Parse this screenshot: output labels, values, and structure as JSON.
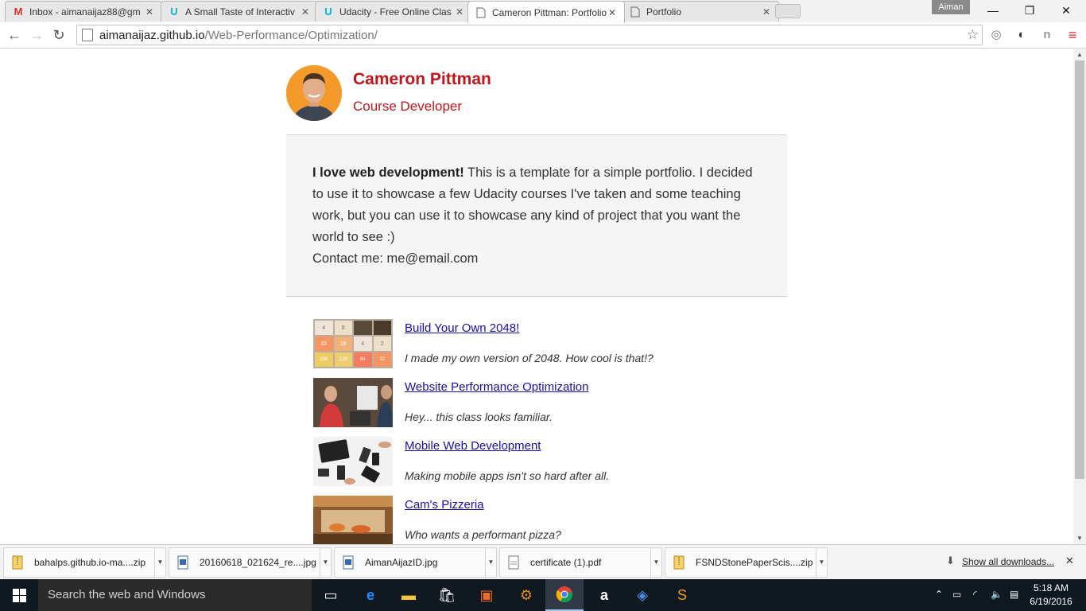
{
  "browser": {
    "tabs": [
      {
        "title": "Inbox - aimanaijaz88@gm",
        "icon": "gmail-icon"
      },
      {
        "title": "A Small Taste of Interactiv",
        "icon": "udacity-icon"
      },
      {
        "title": "Udacity - Free Online Clas",
        "icon": "udacity-icon"
      },
      {
        "title": "Cameron Pittman: Portfolio",
        "icon": "page-icon"
      },
      {
        "title": "Portfolio",
        "icon": "page-icon"
      }
    ],
    "active_tab": 3,
    "profile_name": "Aiman",
    "url_domain": "aimanaijaz.github.io",
    "url_path": "/Web-Performance/Optimization/"
  },
  "page": {
    "name": "Cameron Pittman",
    "role": "Course Developer",
    "intro_bold": "I love web development!",
    "intro_text": " This is a template for a simple portfolio. I decided to use it to showcase a few Udacity courses I've taken and some teaching work, but you can use it to showcase any kind of project that you want the world to see :)",
    "contact": "Contact me: me@email.com",
    "projects": [
      {
        "title": "Build Your Own 2048!",
        "desc": "I made my own version of 2048. How cool is that!?",
        "thumb": "2048-game"
      },
      {
        "title": "Website Performance Optimization",
        "desc": "Hey... this class looks familiar.",
        "thumb": "instructors"
      },
      {
        "title": "Mobile Web Development",
        "desc": "Making mobile apps isn't so hard after all.",
        "thumb": "phones"
      },
      {
        "title": "Cam's Pizzeria",
        "desc": "Who wants a performant pizza?",
        "thumb": "pizzeria"
      }
    ],
    "tiles_2048": [
      "4",
      "8",
      "",
      "",
      "32",
      "16",
      "4",
      "2",
      "256",
      "128",
      "64",
      "32"
    ]
  },
  "downloads": {
    "items": [
      {
        "name": "bahalps.github.io-ma....zip",
        "type": "zip"
      },
      {
        "name": "20160618_021624_re....jpg",
        "type": "image"
      },
      {
        "name": "AimanAijazID.jpg",
        "type": "image"
      },
      {
        "name": "certificate (1).pdf",
        "type": "pdf"
      },
      {
        "name": "FSNDStonePaperScis....zip",
        "type": "zip"
      }
    ],
    "show_all": "Show all downloads..."
  },
  "taskbar": {
    "search_placeholder": "Search the web and Windows",
    "time": "5:18 AM",
    "date": "6/19/2016"
  },
  "colors": {
    "accent_red": "#c0161b",
    "link": "#1a0dab",
    "intro_bg": "#f5f5f5"
  }
}
